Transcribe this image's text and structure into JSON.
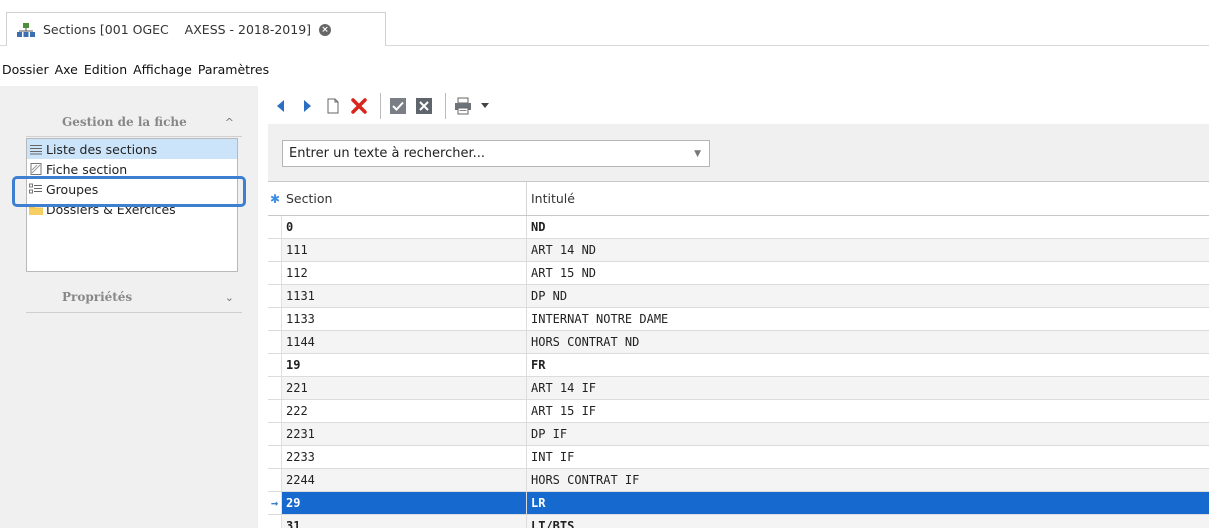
{
  "tab": {
    "title": "Sections [001 OGEC    AXESS - 2018-2019]",
    "icon": "hierarchy-icon",
    "close_icon": "close-circle-icon"
  },
  "menu": [
    "Dossier",
    "Axe",
    "Edition",
    "Affichage",
    "Paramètres"
  ],
  "sidebar": {
    "gestion_header": "Gestion de la fiche",
    "gestion_chevron": "^",
    "items": [
      {
        "label": "Liste des sections",
        "icon": "list-icon",
        "selected": true
      },
      {
        "label": "Fiche section",
        "icon": "form-icon",
        "selected": false
      },
      {
        "label": "Groupes",
        "icon": "groups-icon",
        "selected": false
      },
      {
        "label": "Dossiers & Exercices",
        "icon": "folder-icon",
        "selected": false
      }
    ],
    "proprietes_header": "Propriétés",
    "proprietes_chevron": "v"
  },
  "toolbar": {
    "buttons": [
      "previous-icon",
      "next-icon",
      "new-document-icon",
      "delete-icon",
      "validate-icon",
      "cancel-icon",
      "print-icon",
      "dropdown-arrow-icon"
    ]
  },
  "search": {
    "placeholder": "Entrer un texte à rechercher..."
  },
  "grid": {
    "columns": [
      "Section",
      "Intitulé"
    ],
    "rows": [
      {
        "section": "0",
        "intitule": "ND",
        "bold": true
      },
      {
        "section": "111",
        "intitule": "ART 14 ND"
      },
      {
        "section": "112",
        "intitule": "ART 15 ND"
      },
      {
        "section": "1131",
        "intitule": "DP ND"
      },
      {
        "section": "1133",
        "intitule": "INTERNAT NOTRE DAME"
      },
      {
        "section": "1144",
        "intitule": "HORS CONTRAT ND"
      },
      {
        "section": "19",
        "intitule": "FR",
        "bold": true
      },
      {
        "section": "221",
        "intitule": "ART 14 IF"
      },
      {
        "section": "222",
        "intitule": "ART 15 IF"
      },
      {
        "section": "2231",
        "intitule": "DP IF"
      },
      {
        "section": "2233",
        "intitule": "INT IF"
      },
      {
        "section": "2244",
        "intitule": "HORS CONTRAT IF"
      },
      {
        "section": "29",
        "intitule": "LR",
        "bold": true,
        "selected": true
      },
      {
        "section": "31",
        "intitule": "LT/BTS",
        "bold": true
      }
    ]
  },
  "colors": {
    "selection": "#1669cf",
    "highlight_frame": "#3f7fd2",
    "delete_red": "#d9261c"
  }
}
